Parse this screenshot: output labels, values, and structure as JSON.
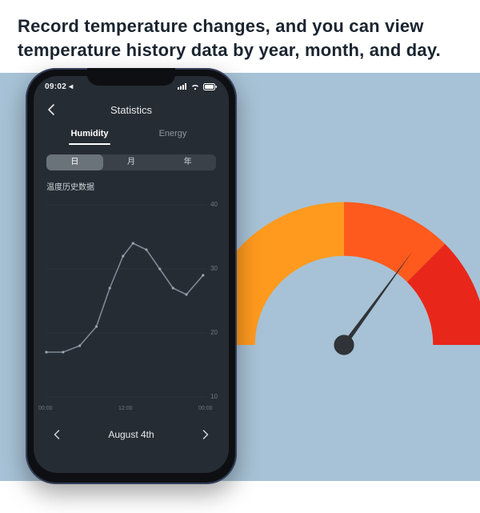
{
  "headline": "Record temperature changes, and you can view temperature history data by year, month, and day.",
  "statusbar": {
    "time": "09:02 ◂"
  },
  "nav": {
    "title": "Statistics"
  },
  "tabs": {
    "humidity": "Humidity",
    "energy": "Energy"
  },
  "segments": {
    "day": "日",
    "month": "月",
    "year": "年"
  },
  "section_label": "温度历史数据",
  "date_nav": {
    "label": "August 4th"
  },
  "chart_data": {
    "type": "line",
    "title": "温度历史数据",
    "xlabel": "",
    "ylabel": "",
    "ylim": [
      10,
      40
    ],
    "xlim": [
      0,
      24
    ],
    "x_ticks": [
      "00:00",
      "12:00",
      "00:00"
    ],
    "y_ticks": [
      10,
      20,
      30,
      40
    ],
    "series": [
      {
        "name": "温度",
        "x": [
          0,
          2.5,
          5,
          7.5,
          9.5,
          11.5,
          13,
          15,
          17,
          19,
          21,
          23.5
        ],
        "values": [
          17,
          17,
          18,
          21,
          27,
          32,
          34,
          33,
          30,
          27,
          26,
          29
        ]
      }
    ]
  },
  "gauge": {
    "colors": {
      "warm": "#ff9a1e",
      "mid": "#ff5a1e",
      "hot": "#e8271a"
    }
  }
}
